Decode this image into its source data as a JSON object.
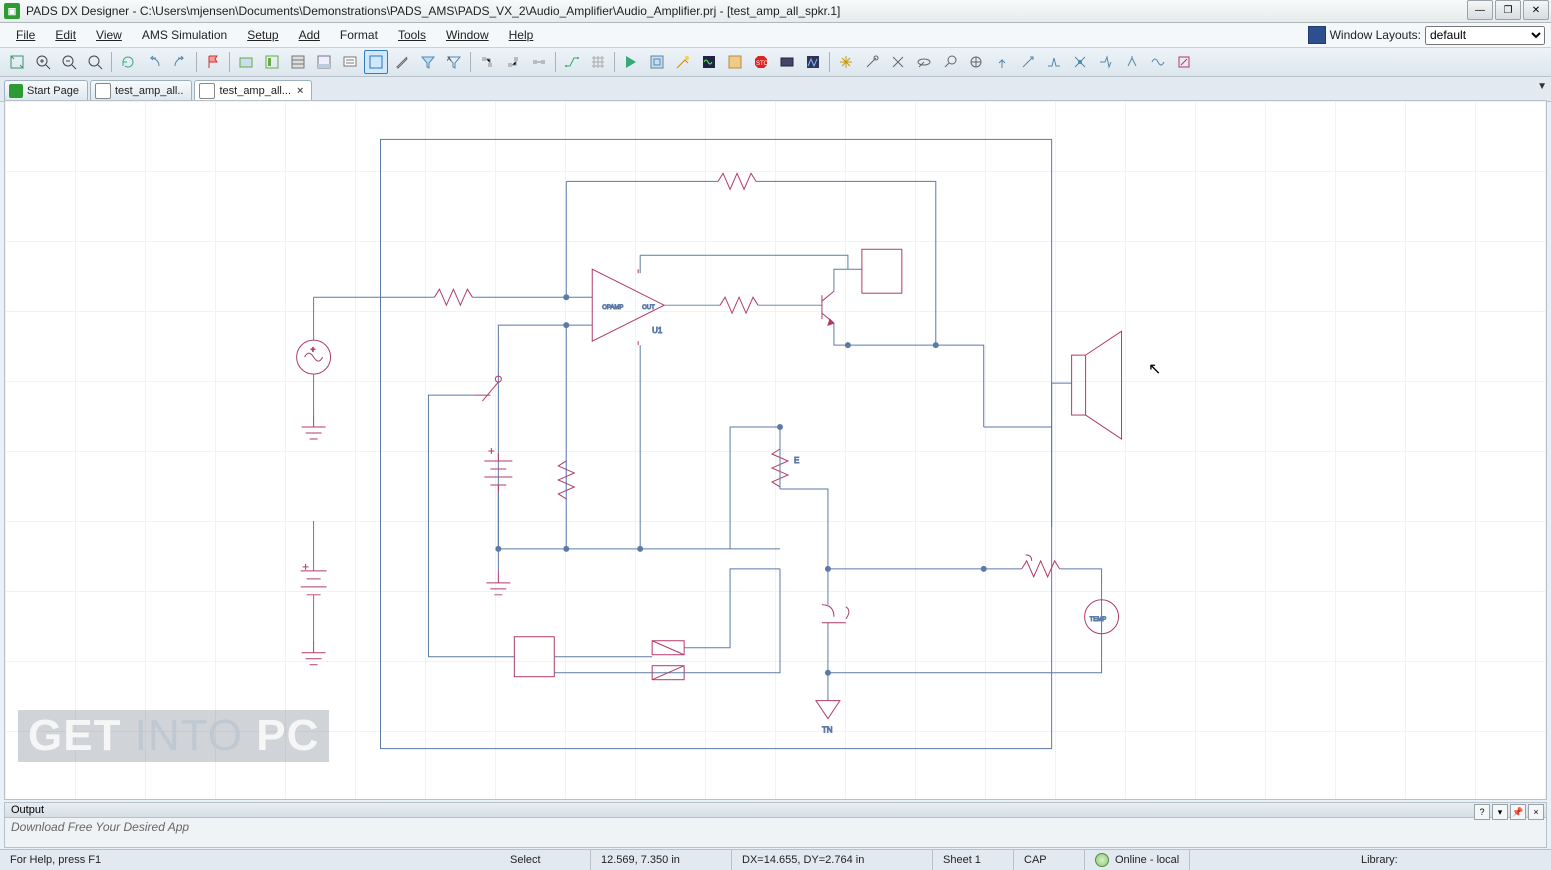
{
  "title": "PADS DX Designer - C:\\Users\\mjensen\\Documents\\Demonstrations\\PADS_AMS\\PADS_VX_2\\Audio_Amplifier\\Audio_Amplifier.prj - [test_amp_all_spkr.1]",
  "menus": [
    "File",
    "Edit",
    "View",
    "AMS Simulation",
    "Setup",
    "Add",
    "Format",
    "Tools",
    "Window",
    "Help"
  ],
  "window_layouts_label": "Window Layouts:",
  "window_layouts_value": "default",
  "tabs": [
    {
      "label": "Start Page",
      "active": false,
      "closable": false
    },
    {
      "label": "test_amp_all..",
      "active": false,
      "closable": false
    },
    {
      "label": "test_amp_all...",
      "active": true,
      "closable": true
    }
  ],
  "schematic_labels": {
    "opamp_in": "OPAMP",
    "opamp_out": "OUT",
    "opamp_ref": "U1",
    "temp": "TEMP",
    "tn": "TN",
    "res_annot": "E"
  },
  "output": {
    "title": "Output",
    "body": "Download Free Your Desired App"
  },
  "status": {
    "help": "For Help, press F1",
    "mode": "Select",
    "coord": "12.569, 7.350 in",
    "delta": "DX=14.655, DY=2.764 in",
    "sheet": "Sheet 1",
    "cap": "CAP",
    "online": "Online - local",
    "library_label": "Library:"
  },
  "watermark": {
    "l1a": "GET",
    "l1b": "INTO",
    "l1c": "PC"
  },
  "window_buttons": {
    "min": "—",
    "max": "❐",
    "close": "✕"
  }
}
